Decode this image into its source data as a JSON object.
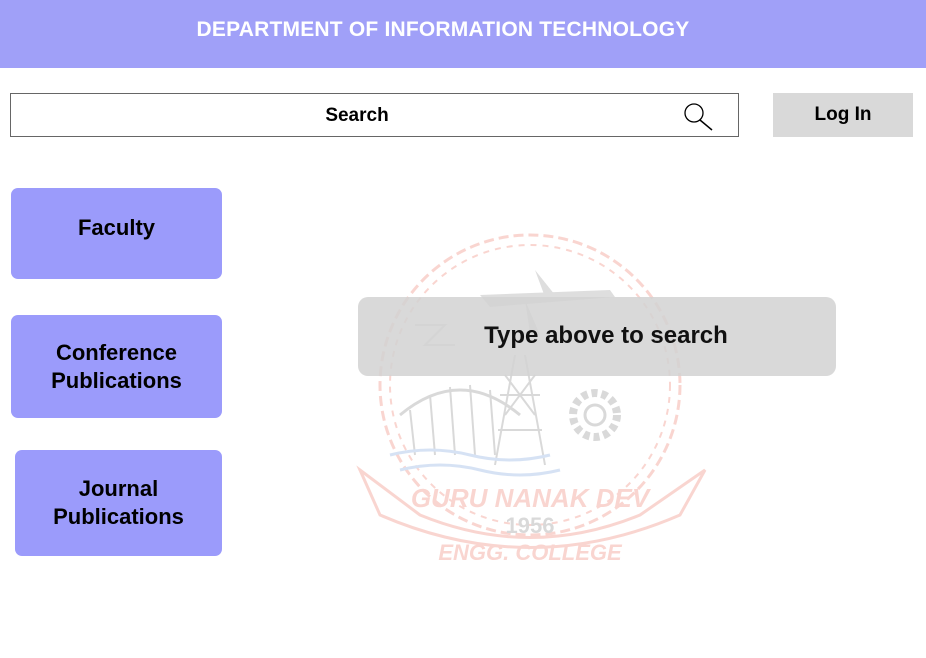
{
  "header": {
    "title": "DEPARTMENT OF INFORMATION TECHNOLOGY"
  },
  "search": {
    "label": "Search",
    "icon": "search-icon"
  },
  "login": {
    "label": "Log In"
  },
  "sidebar": {
    "items": [
      {
        "label": "Faculty"
      },
      {
        "label_line1": "Conference",
        "label_line2": "Publications"
      },
      {
        "label_line1": "Journal",
        "label_line2": "Publications"
      }
    ]
  },
  "watermark": {
    "name": "GURU NANAK DEV",
    "year": "1956",
    "subtitle": "ENGG. COLLEGE",
    "color": "#e8442c"
  },
  "main": {
    "hint": "Type above to search"
  },
  "colors": {
    "header_bg": "#a0a0f8",
    "sidebar_btn": "#9b9bfb",
    "login_bg": "#d9d9d9",
    "hint_bg": "#d2d2d2"
  }
}
